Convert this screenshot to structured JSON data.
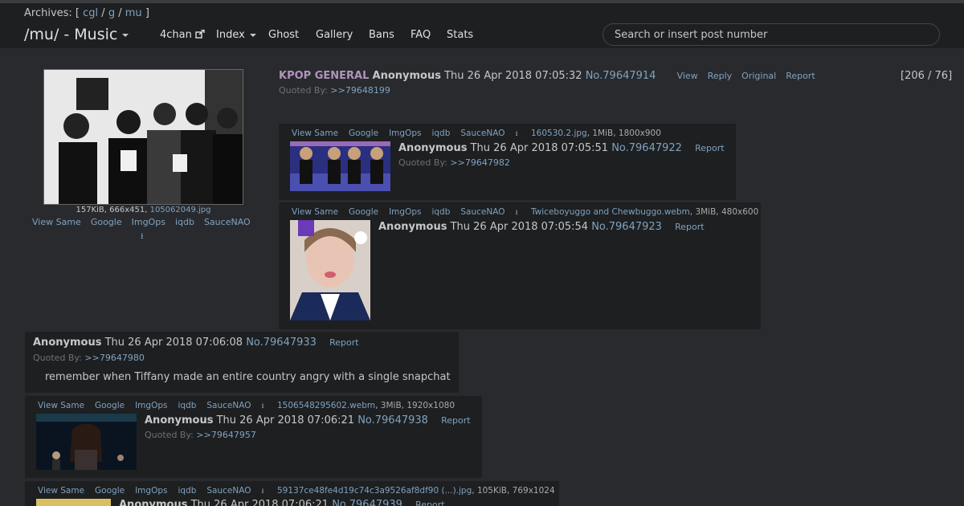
{
  "header": {
    "archives_label": "Archives: [",
    "archives": [
      "cgl",
      "g",
      "mu"
    ],
    "archives_sep": "/",
    "archives_end": "]",
    "board_title": "/mu/ - Music",
    "nav": [
      "4chan",
      "Index",
      "Ghost",
      "Gallery",
      "Bans",
      "FAQ",
      "Stats"
    ],
    "search_placeholder": "Search or insert post number"
  },
  "image_tools": [
    "View Same",
    "Google",
    "ImgOps",
    "iqdb",
    "SauceNAO"
  ],
  "op": {
    "file_size": "157KiB, 666x451, ",
    "file_name": "105062049.jpg",
    "subject": "KPOP GENERAL",
    "name": "Anonymous",
    "date": "Thu 26 Apr 2018 07:05:32",
    "post_no": "No.79647914",
    "actions": [
      "View",
      "Reply",
      "Original",
      "Report"
    ],
    "quoted_label": "Quoted By:",
    "quoted_by": ">>79648199",
    "counter": "[206 / 76]"
  },
  "posts": [
    {
      "file_name": "160530.2.jpg",
      "file_meta": ", 1MiB, 1800x900",
      "name": "Anonymous",
      "date": "Thu 26 Apr 2018 07:05:51",
      "post_no": "No.79647922",
      "report": "Report",
      "quoted_label": "Quoted By:",
      "quoted_by": ">>79647982"
    },
    {
      "file_name": "Twiceboyuggo and Chewbuggo.webm",
      "file_meta": ", 3MiB, 480x600",
      "name": "Anonymous",
      "date": "Thu 26 Apr 2018 07:05:54",
      "post_no": "No.79647923",
      "report": "Report"
    },
    {
      "name": "Anonymous",
      "date": "Thu 26 Apr 2018 07:06:08",
      "post_no": "No.79647933",
      "report": "Report",
      "quoted_label": "Quoted By:",
      "quoted_by": ">>79647980",
      "body": "remember when Tiffany made an entire country angry with a single snapchat"
    },
    {
      "file_name": "1506548295602.webm",
      "file_meta": ", 3MiB, 1920x1080",
      "name": "Anonymous",
      "date": "Thu 26 Apr 2018 07:06:21",
      "post_no": "No.79647938",
      "report": "Report",
      "quoted_label": "Quoted By:",
      "quoted_by": ">>79647957"
    },
    {
      "file_name": "59137ce48fe4d19c74c3a9526af8df90 (...).jpg",
      "file_meta": ", 105KiB, 769x1024",
      "name": "Anonymous",
      "date": "Thu 26 Apr 2018 07:06:21",
      "post_no": "No.79647939",
      "report": "Report"
    }
  ],
  "colors": {
    "background": "#282a2e",
    "post_bg": "#1d1f21",
    "link": "#81a2be",
    "subject": "#b294bb"
  }
}
